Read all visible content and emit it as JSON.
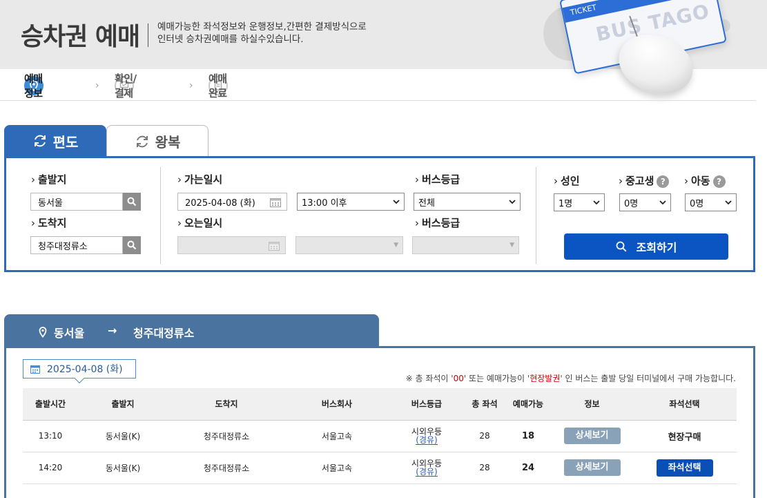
{
  "banner": {
    "title": "승차권 예매",
    "desc_line1": "예매가능한 좌석정보와 운행정보,간편한 결제방식으로",
    "desc_line2": "인터넷 승차권예매를 하실수있습니다.",
    "ticket_label": "TICKET",
    "ticket_logo": "BUS TAGO"
  },
  "steps": [
    {
      "label": "예매정보"
    },
    {
      "label": "확인/결제"
    },
    {
      "label": "예매완료"
    }
  ],
  "tabs": {
    "oneway": "편도",
    "round": "왕복"
  },
  "search": {
    "depart_label": "출발지",
    "depart_value": "동서울",
    "arrive_label": "도착지",
    "arrive_value": "청주대정류소",
    "go_date_label": "가는일시",
    "go_date_value": "2025-04-08 (화)",
    "go_time_value": "13:00 이후",
    "return_date_label": "오는일시",
    "grade_label": "버스등급",
    "grade_value": "전체",
    "grade_label2": "버스등급",
    "adult_label": "성인",
    "adult_value": "1명",
    "student_label": "중고생",
    "student_value": "0명",
    "child_label": "아동",
    "child_value": "0명",
    "query_label": "조회하기"
  },
  "route": {
    "from": "동서울",
    "to": "청주대정류소"
  },
  "result": {
    "date": "2025-04-08 (화)",
    "notice_pre": "※ 총 좌석이 '",
    "notice_zero": "00",
    "notice_mid": "' 또는 예매가능이 '",
    "notice_onsite": "현장발권",
    "notice_post": "' 인 버스는 출발 당일 터미널에서 구매 가능합니다.",
    "headers": [
      "출발시간",
      "출발지",
      "도착지",
      "버스회사",
      "버스등급",
      "총 좌석",
      "예매가능",
      "정보",
      "좌석선택"
    ],
    "rows": [
      {
        "time": "13:10",
        "from": "동서울(K)",
        "to": "청주대정류소",
        "company": "서울고속",
        "grade": "시외우등",
        "via": "(경유)",
        "total": "28",
        "avail": "18",
        "info": "상세보기",
        "select": "현장구매",
        "select_type": "text"
      },
      {
        "time": "14:20",
        "from": "동서울(K)",
        "to": "청주대정류소",
        "company": "서울고속",
        "grade": "시외우등",
        "via": "(경유)",
        "total": "28",
        "avail": "24",
        "info": "상세보기",
        "select": "좌석선택",
        "select_type": "button"
      }
    ]
  },
  "colors": {
    "primary": "#2e6ab8",
    "route_tab": "#4a73a0",
    "query_button": "#0a55c2",
    "notice_red": "#cc0000"
  }
}
